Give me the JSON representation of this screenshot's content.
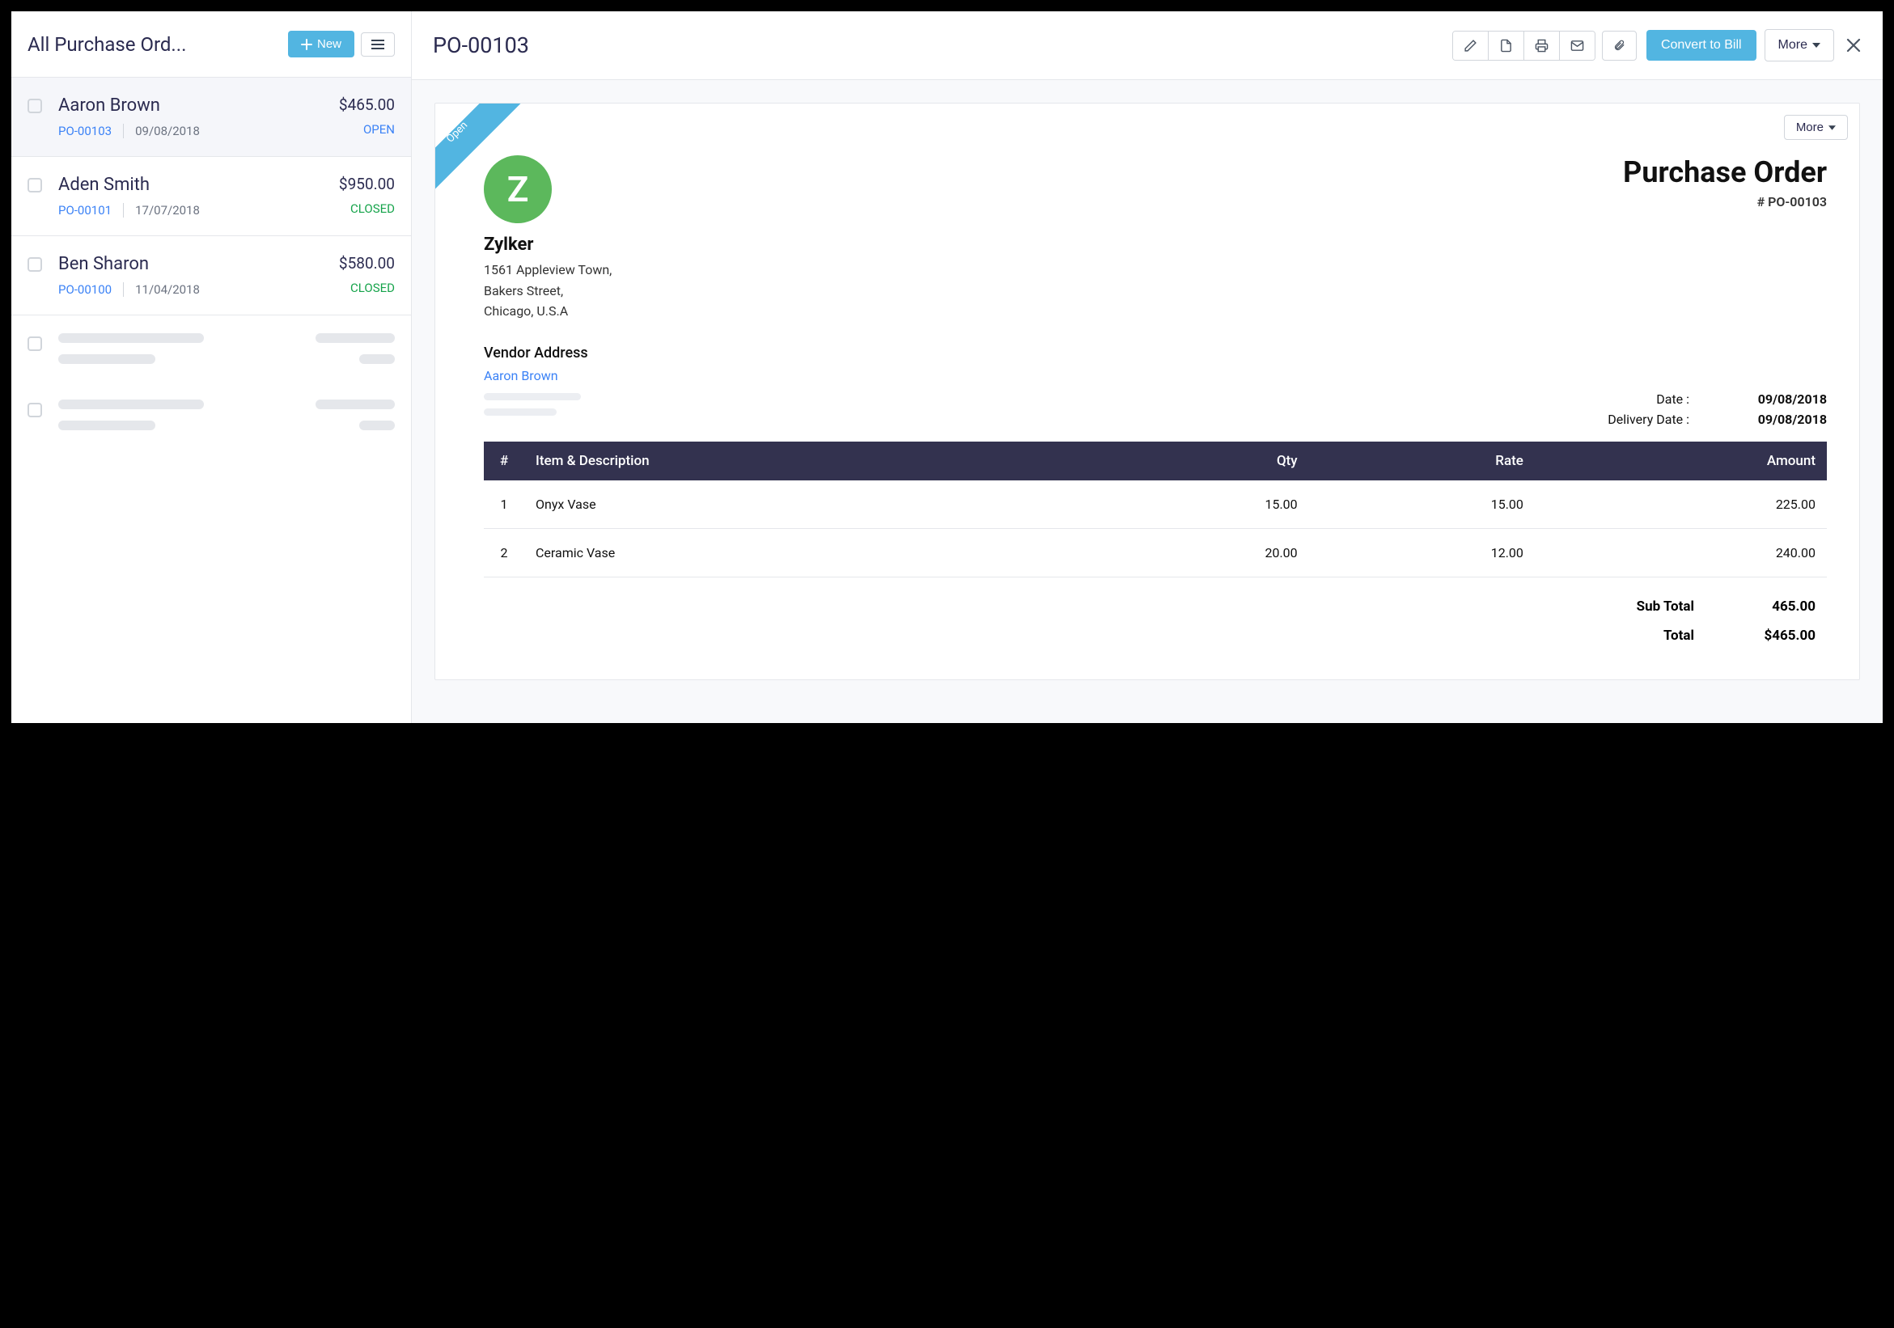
{
  "left": {
    "title": "All Purchase Ord...",
    "new_label": "New",
    "items": [
      {
        "name": "Aaron Brown",
        "po": "PO-00103",
        "date": "09/08/2018",
        "amount": "$465.00",
        "status": "OPEN",
        "status_class": "open",
        "selected": true
      },
      {
        "name": "Aden Smith",
        "po": "PO-00101",
        "date": "17/07/2018",
        "amount": "$950.00",
        "status": "CLOSED",
        "status_class": "closed",
        "selected": false
      },
      {
        "name": "Ben Sharon",
        "po": "PO-00100",
        "date": "11/04/2018",
        "amount": "$580.00",
        "status": "CLOSED",
        "status_class": "closed",
        "selected": false
      }
    ]
  },
  "header": {
    "title": "PO-00103",
    "convert_label": "Convert to Bill",
    "more_label": "More"
  },
  "doc": {
    "ribbon": "Open",
    "more_label": "More",
    "logo_letter": "Z",
    "company_name": "Zylker",
    "addr1": "1561 Appleview Town,",
    "addr2": "Bakers Street,",
    "addr3": "Chicago, U.S.A",
    "title": "Purchase Order",
    "number": "# PO-00103",
    "vendor_label": "Vendor Address",
    "vendor_name": "Aaron Brown",
    "date_label": "Date :",
    "date_value": "09/08/2018",
    "delivery_label": "Delivery Date :",
    "delivery_value": "09/08/2018",
    "cols": {
      "num": "#",
      "desc": "Item & Description",
      "qty": "Qty",
      "rate": "Rate",
      "amount": "Amount"
    },
    "lines": [
      {
        "n": "1",
        "desc": "Onyx Vase",
        "qty": "15.00",
        "rate": "15.00",
        "amount": "225.00"
      },
      {
        "n": "2",
        "desc": "Ceramic Vase",
        "qty": "20.00",
        "rate": "12.00",
        "amount": "240.00"
      }
    ],
    "subtotal_label": "Sub Total",
    "subtotal_value": "465.00",
    "total_label": "Total",
    "total_value": "$465.00"
  }
}
